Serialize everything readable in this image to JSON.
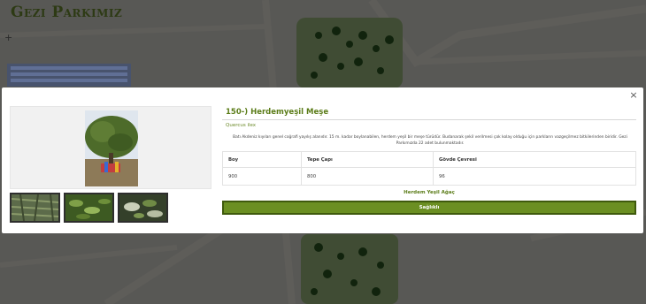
{
  "site": {
    "title": "Gezi Parkımız",
    "zoom_in_label": "+"
  },
  "modal": {
    "close_label": "×",
    "tree_title": "150-) Herdemyeşil Meşe",
    "latin_name": "Quercus ilex",
    "description": "Batı Akdeniz kıyıları genel coğrafi yayılış alanıdır. 15 m. kadar boylanabilen, herdem yeşil bir meşe türüdür. Budanarak şekil verilmesi çok kolay olduğu için parkların vazgeçilmez bitkilerinden biridir. Gezi Parkımızda 22 adet bulunmaktadır.",
    "measures": {
      "headers": [
        "Boy",
        "Tepe Çapı",
        "Gövde Çevresi"
      ],
      "values": [
        "900",
        "800",
        "96"
      ]
    },
    "category_label": "Herdem Yeşil Ağaç",
    "health_button": "Sağlıklı"
  },
  "colors": {
    "accent_green": "#5b7c18",
    "button_green": "#6b8f22",
    "button_border": "#3f5a0d"
  },
  "icons": {
    "close": "close-icon",
    "zoom": "plus-icon"
  }
}
